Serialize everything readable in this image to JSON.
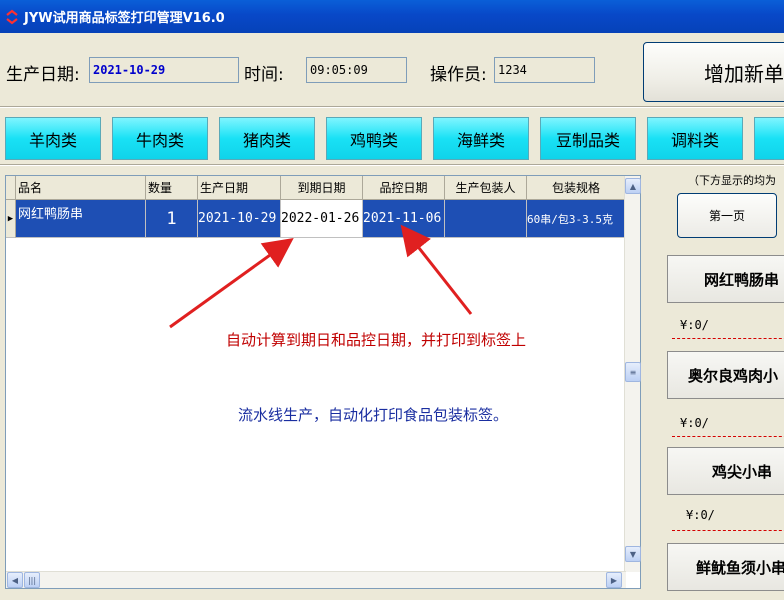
{
  "window": {
    "title": "JYW试用商品标签打印管理V16.0"
  },
  "header": {
    "date_label": "生产日期:",
    "date_value": "2021-10-29",
    "time_label": "时间:",
    "time_value": "09:05:09",
    "operator_label": "操作员:",
    "operator_value": "1234",
    "add_button": "增加新单"
  },
  "categories": [
    "羊肉类",
    "牛肉类",
    "猪肉类",
    "鸡鸭类",
    "海鲜类",
    "豆制品类",
    "调料类"
  ],
  "grid": {
    "columns": [
      "品名",
      "数量",
      "生产日期",
      "到期日期",
      "品控日期",
      "生产包装人",
      "包装规格"
    ],
    "rows": [
      {
        "name": "网红鸭肠串",
        "qty": "1",
        "prod_date": "2021-10-29",
        "expire_date": "2022-01-26",
        "qc_date": "2021-11-06",
        "packer": "",
        "spec": "60串/包3-3.5克"
      }
    ]
  },
  "annotations": {
    "note1": "自动计算到期日和品控日期，并打印到标签上",
    "note2": "流水线生产，自动化打印食品包装标签。"
  },
  "right_panel": {
    "note": "（下方显示的均为",
    "first_page": "第一页",
    "products": [
      {
        "name": "网红鸭肠串",
        "price": "¥:0/"
      },
      {
        "name": "奥尔良鸡肉小",
        "price": "¥:0/"
      },
      {
        "name": "鸡尖小串",
        "price": "¥:0/"
      },
      {
        "name": "鲜鱿鱼须小串"
      }
    ]
  },
  "colors": {
    "titlebar": "#0848c8",
    "category_button": "#19e1f5",
    "selected_row": "#1e4fb4",
    "arrow": "#e02020",
    "note1": "#c00000",
    "note2": "#1a2ea0"
  }
}
